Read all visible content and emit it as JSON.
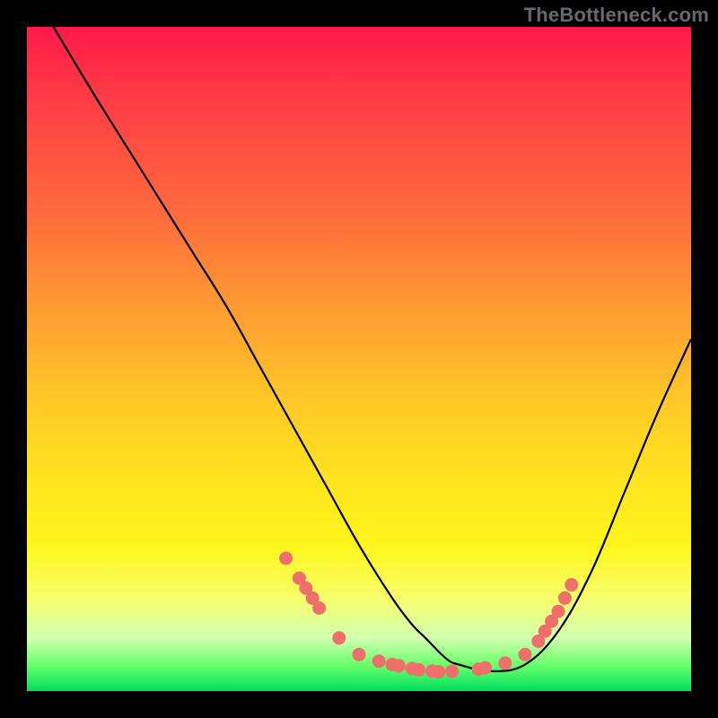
{
  "watermark": "TheBottleneck.com",
  "colors": {
    "frame_background": "#000000",
    "gradient_top": "#ff1a4a",
    "gradient_bottom": "#00e060",
    "curve_stroke": "#000000",
    "marker_fill": "#ef6f6b",
    "marker_stroke": "#c94f4c"
  },
  "chart_data": {
    "type": "line",
    "title": "",
    "xlabel": "",
    "ylabel": "",
    "xlim": [
      0,
      100
    ],
    "ylim": [
      0,
      100
    ],
    "grid": false,
    "legend": false,
    "series": [
      {
        "name": "curve",
        "x": [
          4,
          10,
          15,
          20,
          25,
          30,
          35,
          40,
          45,
          50,
          55,
          58,
          60,
          63,
          65,
          70,
          75,
          80,
          85,
          90,
          95,
          100
        ],
        "values": [
          100,
          90,
          82,
          74,
          66,
          58,
          49,
          40,
          31,
          22,
          14,
          10,
          8,
          5,
          4,
          3,
          4,
          9,
          18,
          30,
          42,
          53
        ]
      }
    ],
    "markers": [
      {
        "x": 39,
        "y": 20
      },
      {
        "x": 41,
        "y": 17
      },
      {
        "x": 42,
        "y": 15.5
      },
      {
        "x": 43,
        "y": 14
      },
      {
        "x": 44,
        "y": 12.5
      },
      {
        "x": 47,
        "y": 8
      },
      {
        "x": 50,
        "y": 5.5
      },
      {
        "x": 53,
        "y": 4.5
      },
      {
        "x": 55,
        "y": 4
      },
      {
        "x": 56,
        "y": 3.8
      },
      {
        "x": 58,
        "y": 3.4
      },
      {
        "x": 59,
        "y": 3.2
      },
      {
        "x": 61,
        "y": 3.0
      },
      {
        "x": 62,
        "y": 2.9
      },
      {
        "x": 64,
        "y": 3.0
      },
      {
        "x": 68,
        "y": 3.3
      },
      {
        "x": 69,
        "y": 3.5
      },
      {
        "x": 72,
        "y": 4.2
      },
      {
        "x": 75,
        "y": 5.5
      },
      {
        "x": 77,
        "y": 7.5
      },
      {
        "x": 78,
        "y": 9
      },
      {
        "x": 79,
        "y": 10.5
      },
      {
        "x": 80,
        "y": 12
      },
      {
        "x": 81,
        "y": 14
      },
      {
        "x": 82,
        "y": 16
      }
    ]
  }
}
